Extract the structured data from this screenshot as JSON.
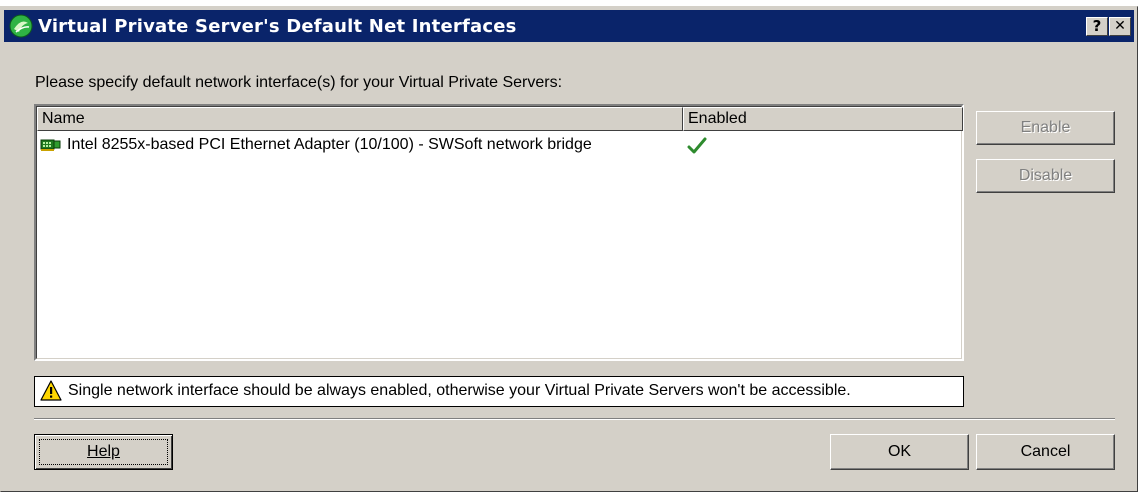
{
  "dialog": {
    "title": "Virtual Private Server's Default Net Interfaces",
    "help_glyph": "?",
    "close_glyph": "✕"
  },
  "prompt": "Please specify default network interface(s) for your Virtual Private Servers:",
  "list": {
    "columns": [
      "Name",
      "Enabled"
    ],
    "rows": [
      {
        "name": "Intel 8255x-based PCI Ethernet Adapter (10/100) - SWSoft network bridge",
        "enabled": true,
        "icon": "network-card-icon"
      }
    ]
  },
  "side_buttons": {
    "enable": "Enable",
    "disable": "Disable"
  },
  "warning": {
    "icon": "warning-icon",
    "text": "Single network interface should be always enabled, otherwise your Virtual Private Servers won't be accessible."
  },
  "footer": {
    "help": "Help",
    "ok": "OK",
    "cancel": "Cancel"
  },
  "colors": {
    "titlebar": "#0a246a",
    "dialog_bg": "#d4d0c8",
    "check": "#2e8b2e",
    "warning": "#ffd700"
  }
}
